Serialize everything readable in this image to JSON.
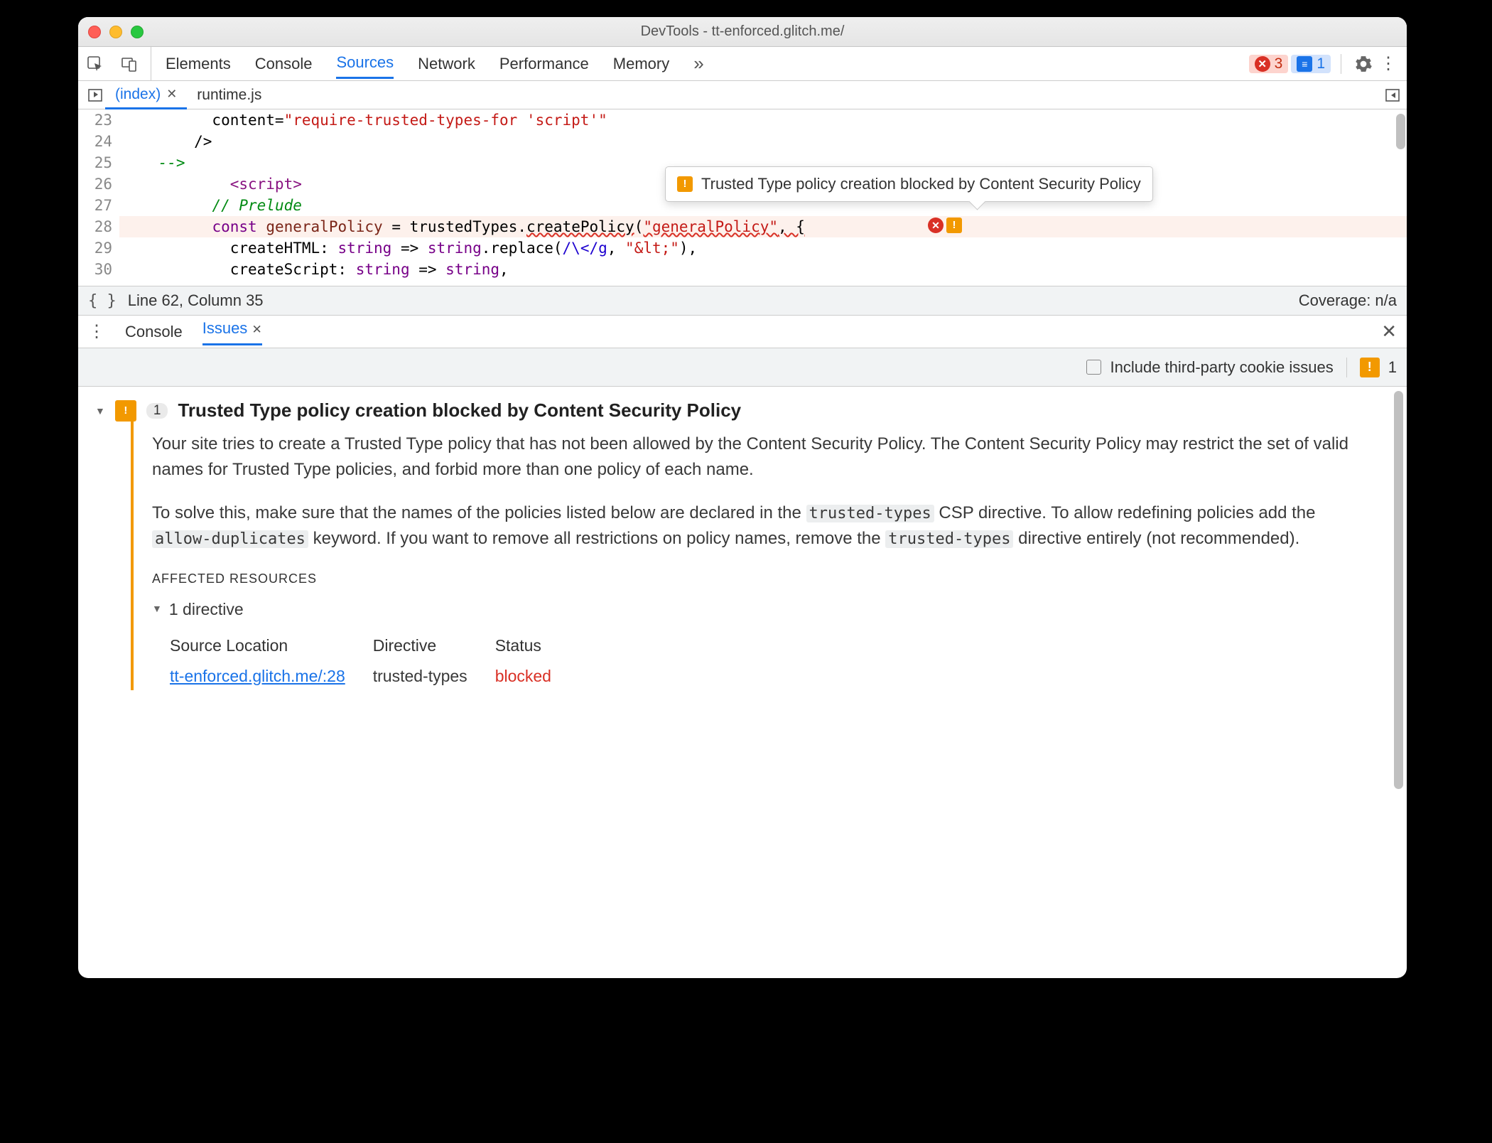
{
  "window_title": "DevTools - tt-enforced.glitch.me/",
  "main_tabs": [
    "Elements",
    "Console",
    "Sources",
    "Network",
    "Performance",
    "Memory"
  ],
  "main_tabs_active": "Sources",
  "counters": {
    "errors": 3,
    "messages": 1
  },
  "file_tabs": {
    "tabs": [
      "(index)",
      "runtime.js"
    ],
    "active": "(index)"
  },
  "code": {
    "first_line": 23,
    "highlight_line": 28,
    "tooltip_text": "Trusted Type policy creation blocked by Content Security Policy",
    "lines": [
      {
        "no": 23,
        "indent": 10,
        "html": "content=<span class='tok-str'>\"require-trusted-types-for 'script'\"</span>"
      },
      {
        "no": 24,
        "indent": 8,
        "html": "/&gt;"
      },
      {
        "no": 25,
        "indent": 4,
        "html": "<span class='tok-cmt'>--&gt;</span>"
      },
      {
        "no": 26,
        "indent": 12,
        "html": "<span class='tok-tag'>&lt;script&gt;</span>"
      },
      {
        "no": 27,
        "indent": 10,
        "html": "<span class='tok-cmt'>// Prelude</span>"
      },
      {
        "no": 28,
        "indent": 10,
        "html": "<span class='tok-kw'>const</span> <span class='tok-fn'>generalPolicy</span> = trustedTypes.<span class='wavy'>createPolicy</span>(<span class='tok-str wavy'>\"generalPolicy\"</span><span class='wavy'>, {</span>"
      },
      {
        "no": 29,
        "indent": 12,
        "html": "createHTML: <span class='tok-kw'>string</span> =&gt; <span class='tok-kw'>string</span>.replace(<span class='tok-regex'>/\\&lt;/g</span>, <span class='tok-str'>\"&amp;lt;\"</span>),"
      },
      {
        "no": 30,
        "indent": 12,
        "html": "createScript: <span class='tok-kw'>string</span> =&gt; <span class='tok-kw'>string</span>,"
      }
    ]
  },
  "status": {
    "cursor": "Line 62, Column 35",
    "coverage": "Coverage: n/a"
  },
  "drawer": {
    "tabs": [
      "Console",
      "Issues"
    ],
    "active": "Issues"
  },
  "issues_toolbar": {
    "label": "Include third-party cookie issues",
    "count": 1
  },
  "issue": {
    "count": 1,
    "title": "Trusted Type policy creation blocked by Content Security Policy",
    "para1_a": "Your site tries to create a Trusted Type policy that has not been allowed by the Content Security Policy. The Content Security Policy may restrict the set of valid names for Trusted Type policies, and forbid more than one policy of each name.",
    "para2_a": "To solve this, make sure that the names of the policies listed below are declared in the ",
    "para2_code1": "trusted-types",
    "para2_b": " CSP directive. To allow redefining policies add the ",
    "para2_code2": "allow-duplicates",
    "para2_c": " keyword. If you want to remove all restrictions on policy names, remove the ",
    "para2_code3": "trusted-types",
    "para2_d": " directive entirely (not recommended).",
    "affected_label": "AFFECTED RESOURCES",
    "directive_count_label": "1 directive",
    "table": {
      "headers": [
        "Source Location",
        "Directive",
        "Status"
      ],
      "row": {
        "source": "tt-enforced.glitch.me/:28",
        "directive": "trusted-types",
        "status": "blocked"
      }
    }
  }
}
